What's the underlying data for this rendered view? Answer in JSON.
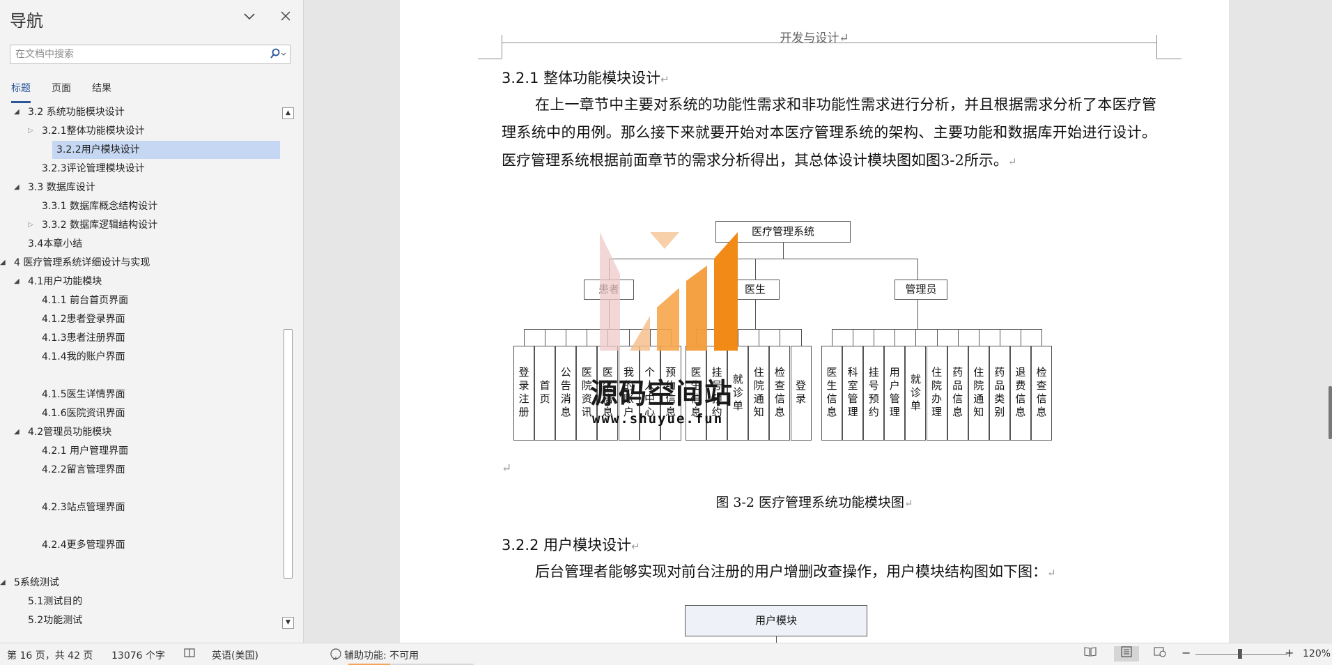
{
  "nav": {
    "title": "导航",
    "search_placeholder": "在文档中搜索",
    "tabs": [
      {
        "label": "标题",
        "active": true
      },
      {
        "label": "页面",
        "active": false
      },
      {
        "label": "结果",
        "active": false
      }
    ],
    "items": [
      {
        "label": "3.2 系统功能模块设计",
        "level": 2,
        "toggle": "open",
        "selected": false
      },
      {
        "label": "3.2.1整体功能模块设计",
        "level": 3,
        "toggle": "closed",
        "selected": false
      },
      {
        "label": "3.2.2用户模块设计",
        "level": 3,
        "toggle": "none",
        "selected": true
      },
      {
        "label": "3.2.3评论管理模块设计",
        "level": 3,
        "toggle": "none",
        "selected": false
      },
      {
        "label": "3.3 数据库设计",
        "level": 2,
        "toggle": "open",
        "selected": false
      },
      {
        "label": "3.3.1 数据库概念结构设计",
        "level": 3,
        "toggle": "none",
        "selected": false
      },
      {
        "label": "3.3.2 数据库逻辑结构设计",
        "level": 3,
        "toggle": "closed",
        "selected": false
      },
      {
        "label": "3.4本章小结",
        "level": 2,
        "toggle": "none",
        "selected": false
      },
      {
        "label": "4 医疗管理系统详细设计与实现",
        "level": 1,
        "toggle": "open",
        "selected": false
      },
      {
        "label": "4.1用户功能模块",
        "level": 2,
        "toggle": "open",
        "selected": false
      },
      {
        "label": "4.1.1 前台首页界面",
        "level": 3,
        "toggle": "none",
        "selected": false
      },
      {
        "label": "4.1.2患者登录界面",
        "level": 3,
        "toggle": "none",
        "selected": false
      },
      {
        "label": "4.1.3患者注册界面",
        "level": 3,
        "toggle": "none",
        "selected": false
      },
      {
        "label": "4.1.4我的账户界面",
        "level": 3,
        "toggle": "none",
        "selected": false
      },
      {
        "label": "",
        "level": 3,
        "toggle": "none",
        "selected": false
      },
      {
        "label": "4.1.5医生详情界面",
        "level": 3,
        "toggle": "none",
        "selected": false
      },
      {
        "label": "4.1.6医院资讯界面",
        "level": 3,
        "toggle": "none",
        "selected": false
      },
      {
        "label": "4.2管理员功能模块",
        "level": 2,
        "toggle": "open",
        "selected": false
      },
      {
        "label": "4.2.1 用户管理界面",
        "level": 3,
        "toggle": "none",
        "selected": false
      },
      {
        "label": "4.2.2留言管理界面",
        "level": 3,
        "toggle": "none",
        "selected": false
      },
      {
        "label": "",
        "level": 3,
        "toggle": "none",
        "selected": false
      },
      {
        "label": "4.2.3站点管理界面",
        "level": 3,
        "toggle": "none",
        "selected": false
      },
      {
        "label": "",
        "level": 3,
        "toggle": "none",
        "selected": false
      },
      {
        "label": "4.2.4更多管理界面",
        "level": 3,
        "toggle": "none",
        "selected": false
      },
      {
        "label": "",
        "level": 3,
        "toggle": "none",
        "selected": false
      },
      {
        "label": "5系统测试",
        "level": 1,
        "toggle": "open",
        "selected": false
      },
      {
        "label": "5.1测试目的",
        "level": 2,
        "toggle": "none",
        "selected": false
      },
      {
        "label": "5.2功能测试",
        "level": 2,
        "toggle": "none",
        "selected": false
      }
    ]
  },
  "doc": {
    "header": "开发与设计↵",
    "h_321": "3.2.1 整体功能模块设计",
    "para1": "在上一章节中主要对系统的功能性需求和非功能性需求进行分析，并且根据需求分析了本医疗管理系统中的用例。那么接下来就要开始对本医疗管理系统的架构、主要功能和数据库开始进行设计。医疗管理系统根据前面章节的需求分析得出，其总体设计模块图如图3-2所示。",
    "ret": "↵",
    "chart": {
      "root": "医疗管理系统",
      "user": "患者",
      "doctor": "医生",
      "admin": "管理员",
      "user_leaves": [
        "登录注册",
        "首页",
        "公告消息",
        "医院资讯",
        "医生信息",
        "我的账户",
        "个人中心",
        "预约信息"
      ],
      "doctor_leaves": [
        "医生信息",
        "挂号预约",
        "就诊单",
        "住院通知",
        "检查信息",
        "登录"
      ],
      "admin_leaves": [
        "医生信息",
        "科室管理",
        "挂号预约",
        "用户管理",
        "就诊单",
        "住院办理",
        "药品信息",
        "住院通知",
        "药品类别",
        "退费信息",
        "检查信息"
      ]
    },
    "caption": "图 3-2 医疗管理系统功能模块图",
    "h_322": "3.2.2 用户模块设计",
    "para2": "后台管理者能够实现对前台注册的用户增删改查操作，用户模块结构图如下图：",
    "user_module": "用户模块"
  },
  "watermark": {
    "text": "源码空间站",
    "url": "www.shuyue.fun"
  },
  "status": {
    "page": "第 16 页，共 42 页",
    "words": "13076 个字",
    "language": "英语(美国)",
    "accessibility": "辅助功能: 不可用",
    "zoom": "120%"
  }
}
